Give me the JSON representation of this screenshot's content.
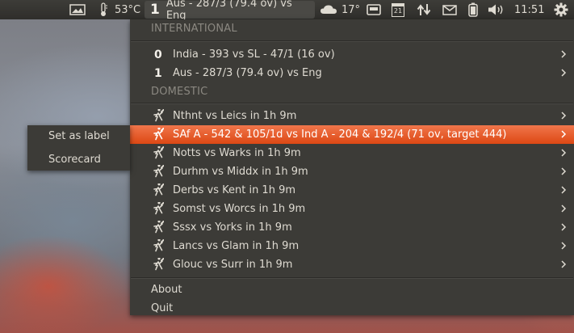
{
  "panel": {
    "temperature": "53°C",
    "cricket_number": "1",
    "cricket_label": "Aus - 287/3 (79.4 ov) vs Eng",
    "weather_temp": "17°",
    "calendar_day": "21",
    "clock": "11:51"
  },
  "menu": {
    "international_header": "INTERNATIONAL",
    "international": [
      {
        "number": "0",
        "label": "India - 393 vs SL - 47/1 (16 ov)"
      },
      {
        "number": "1",
        "label": "Aus - 287/3 (79.4 ov) vs Eng"
      }
    ],
    "domestic_header": "DOMESTIC",
    "domestic": [
      {
        "label": "Nthnt vs Leics in 1h 9m",
        "highlighted": false
      },
      {
        "label": "SAf A - 542 & 105/1d vs Ind A - 204 & 192/4 (71 ov, target 444)",
        "highlighted": true
      },
      {
        "label": "Notts vs Warks in 1h 9m",
        "highlighted": false
      },
      {
        "label": "Durhm vs Middx in 1h 9m",
        "highlighted": false
      },
      {
        "label": "Derbs vs Kent in 1h 9m",
        "highlighted": false
      },
      {
        "label": "Somst vs Worcs in 1h 9m",
        "highlighted": false
      },
      {
        "label": "Sssx vs Yorks in 1h 9m",
        "highlighted": false
      },
      {
        "label": "Lancs vs Glam in 1h 9m",
        "highlighted": false
      },
      {
        "label": "Glouc vs Surr in 1h 9m",
        "highlighted": false
      }
    ],
    "about": "About",
    "quit": "Quit"
  },
  "submenu": {
    "items": [
      "Set as label",
      "Scorecard"
    ]
  },
  "colors": {
    "highlight": "#dd4814",
    "menu_bg": "#3c3b37",
    "panel_bg": "#3d3c38"
  }
}
